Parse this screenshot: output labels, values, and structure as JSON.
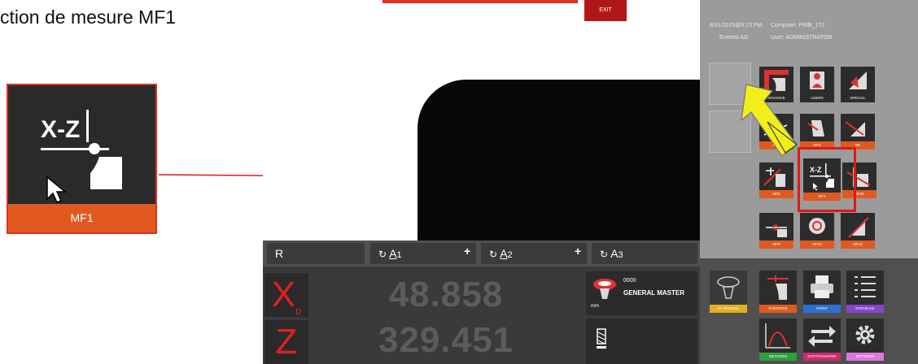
{
  "page": {
    "heading": "ction de mesure MF1"
  },
  "zoom_tile": {
    "glyph": "X-Z",
    "label": "MF1"
  },
  "app": {
    "status": {
      "datetime": "8/31/2015@5:13 PM",
      "company": "Everest AG",
      "computer": "Computer: PWB_172",
      "user": "User: ADMINISTRATOR"
    },
    "exit_label": "EXIT",
    "top_tiles": [
      {
        "label": "ADVANCE",
        "icon": "advance-icon"
      },
      {
        "label": "USERS",
        "icon": "users-icon"
      },
      {
        "label": "SPECIAL",
        "icon": "special-icon"
      }
    ],
    "measure_tiles": [
      {
        "label": "MF1",
        "icon": "mf-icon",
        "row": 0,
        "col": 0
      },
      {
        "label": "MF3",
        "icon": "mf-icon",
        "row": 0,
        "col": 1
      },
      {
        "label": "MK",
        "icon": "mk-icon",
        "row": 0,
        "col": 2
      },
      {
        "label": "MF5",
        "icon": "mf-icon",
        "row": 1,
        "col": 0
      },
      {
        "label": "MF1",
        "icon": "mf1-icon",
        "row": 1,
        "col": 1
      },
      {
        "label": "MF22",
        "icon": "mf-icon",
        "row": 1,
        "col": 2
      },
      {
        "label": "MF8",
        "icon": "mf-icon",
        "row": 2,
        "col": 0
      },
      {
        "label": "MF30",
        "icon": "mf-icon",
        "row": 2,
        "col": 1
      },
      {
        "label": "MF12",
        "icon": "mf-icon",
        "row": 2,
        "col": 2
      }
    ],
    "axes": {
      "r_label": "R",
      "a1_prefix": "↻",
      "a1_letter": "A",
      "a1_sub": "1",
      "a2_prefix": "↻",
      "a2_letter": "A",
      "a2_sub": "2",
      "a3_prefix": "↻",
      "a3_letter": "A",
      "a3_sub": "3",
      "plus": "+"
    },
    "dro": {
      "x_letter": "X",
      "x_sub": "D",
      "x_value": "48.858",
      "z_letter": "Z",
      "z_value": "329.451"
    },
    "master": {
      "code": "0000",
      "name": "GENERAL MASTER",
      "unit": "mm"
    },
    "bottom_menu": [
      {
        "label": "KV SPINDLE",
        "color": "#e0b020"
      },
      {
        "label": "FUNTIONS",
        "color": "#e05a20"
      },
      {
        "label": "PRINT",
        "color": "#2f6fd0"
      },
      {
        "label": "DATABASE",
        "color": "#8844cc"
      },
      {
        "label": "METHODS",
        "color": "#2e9e3e"
      },
      {
        "label": "DATATRANSFER",
        "color": "#cc2a6a"
      },
      {
        "label": "SETTINGS",
        "color": "#dd77dd"
      }
    ],
    "colors": {
      "accent": "#e05a20",
      "alarm_red": "#e01818",
      "annotation_arrow": "#f2ee1a"
    }
  }
}
